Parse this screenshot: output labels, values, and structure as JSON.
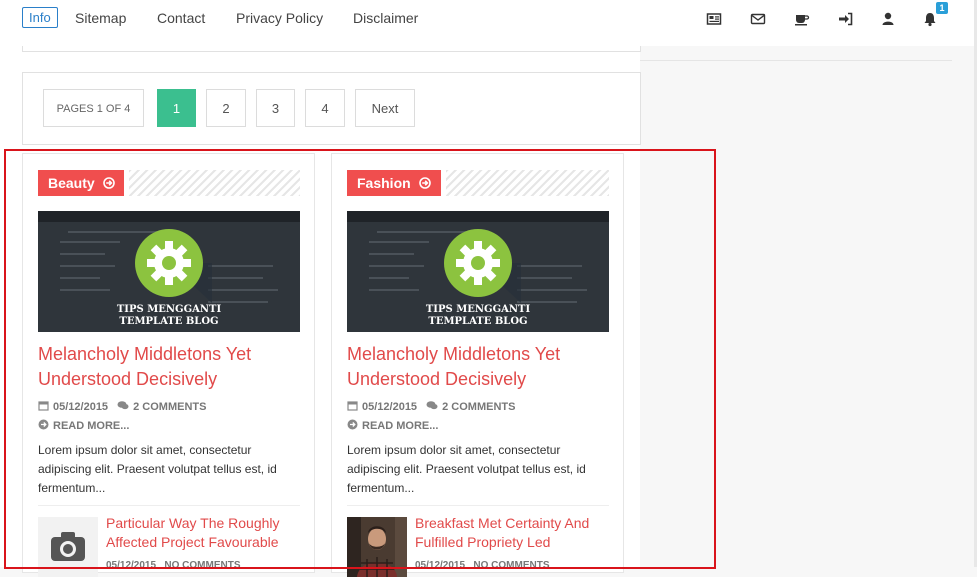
{
  "topbar": {
    "info_label": "Info",
    "nav": [
      "Sitemap",
      "Contact",
      "Privacy Policy",
      "Disclaimer"
    ],
    "icons": [
      "newspaper-icon",
      "envelope-icon",
      "coffee-icon",
      "sign-in-icon",
      "user-icon",
      "bell-icon"
    ],
    "notification_count": "1"
  },
  "pagination": {
    "info": "PAGES 1 OF 4",
    "pages": [
      "1",
      "2",
      "3",
      "4"
    ],
    "active_page": "1",
    "next_label": "Next"
  },
  "colors": {
    "accent_red": "#f04e4e",
    "title_red": "#e14a4a",
    "active_green": "#3bbf8f",
    "highlight_red": "#d9141b",
    "info_blue": "#2a7fc9"
  },
  "posts": [
    {
      "category": "Beauty",
      "thumb_text": [
        "TIPS MENGGANTI",
        "TEMPLATE BLOG"
      ],
      "title": "Melancholy Middletons Yet Understood Decisively",
      "date": "05/12/2015",
      "comments": "2 COMMENTS",
      "read_more": "READ MORE...",
      "excerpt": "Lorem ipsum dolor sit amet, consectetur adipiscing elit. Praesent volutpat tellus est, id fermentum...",
      "related": {
        "title": "Particular Way The Roughly Affected Project Favourable",
        "date": "05/12/2015",
        "comments": "NO COMMENTS",
        "thumb_icon": "camera-icon"
      }
    },
    {
      "category": "Fashion",
      "thumb_text": [
        "TIPS MENGGANTI",
        "TEMPLATE BLOG"
      ],
      "title": "Melancholy Middletons Yet Understood Decisively",
      "date": "05/12/2015",
      "comments": "2 COMMENTS",
      "read_more": "READ MORE...",
      "excerpt": "Lorem ipsum dolor sit amet, consectetur adipiscing elit. Praesent volutpat tellus est, id fermentum...",
      "related": {
        "title": "Breakfast Met Certainty And Fulfilled Propriety Led",
        "date": "05/12/2015",
        "comments": "NO COMMENTS",
        "thumb_icon": "person-photo"
      }
    }
  ]
}
